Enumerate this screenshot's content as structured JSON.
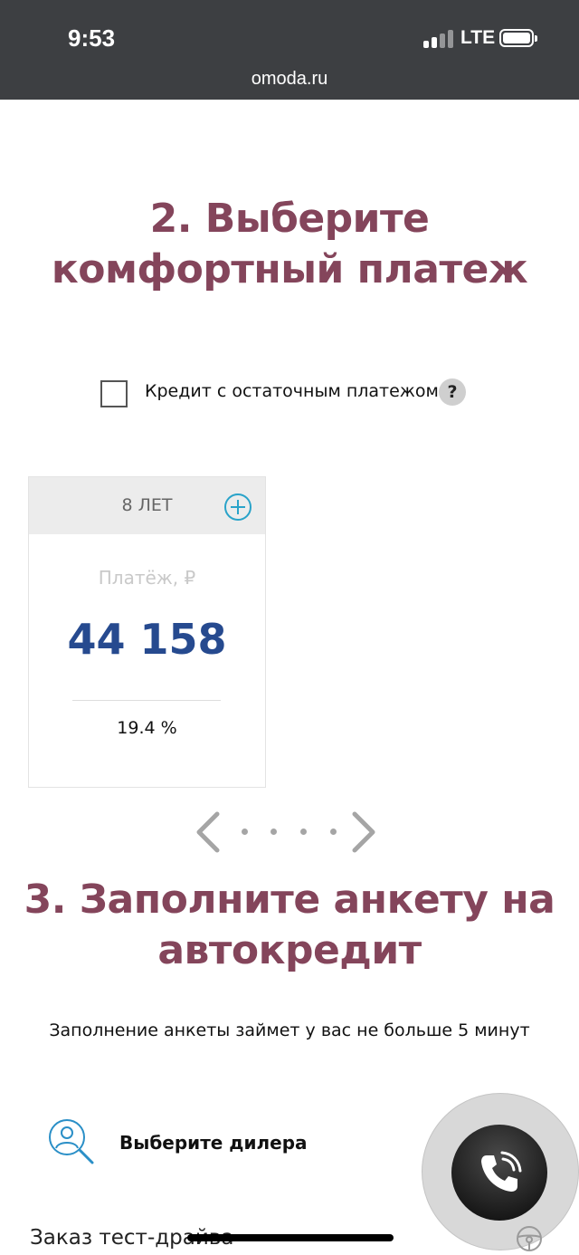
{
  "status_bar": {
    "time": "9:53",
    "network": "LTE",
    "signal_bars_active": 2,
    "signal_bars_total": 4,
    "battery_level": 1.0
  },
  "browser": {
    "url": "omoda.ru"
  },
  "step2": {
    "title_line1": "2. Выберите",
    "title_line2": "комфортный платеж",
    "checkbox_label": "Кредит с остаточным платежом",
    "checkbox_checked": false,
    "help_symbol": "?"
  },
  "offer_card": {
    "term": "8 ЛЕТ",
    "payment_label": "Платёж, ₽",
    "payment_value": "44 158",
    "rate": "19.4 %"
  },
  "pager": {
    "dots_count": 4
  },
  "step3": {
    "title_line1": "3. Заполните анкету на",
    "title_line2": "автокредит",
    "subtitle": "Заполнение анкеты займет у вас не больше 5 минут"
  },
  "steps": {
    "dealer_label": "Выберите дилера",
    "test_drive_label": "Заказ тест-драйва"
  },
  "colors": {
    "heading": "#84455b",
    "payment_value": "#264a8f",
    "plus_icon": "#29a3c9",
    "topbar": "#3d3f42"
  },
  "icons": {
    "plus": "plus-circle-icon",
    "help": "question-icon",
    "prev": "chevron-left-icon",
    "next": "chevron-right-icon",
    "dealer": "person-search-icon",
    "call": "phone-call-icon",
    "wheel": "steering-wheel-icon"
  }
}
